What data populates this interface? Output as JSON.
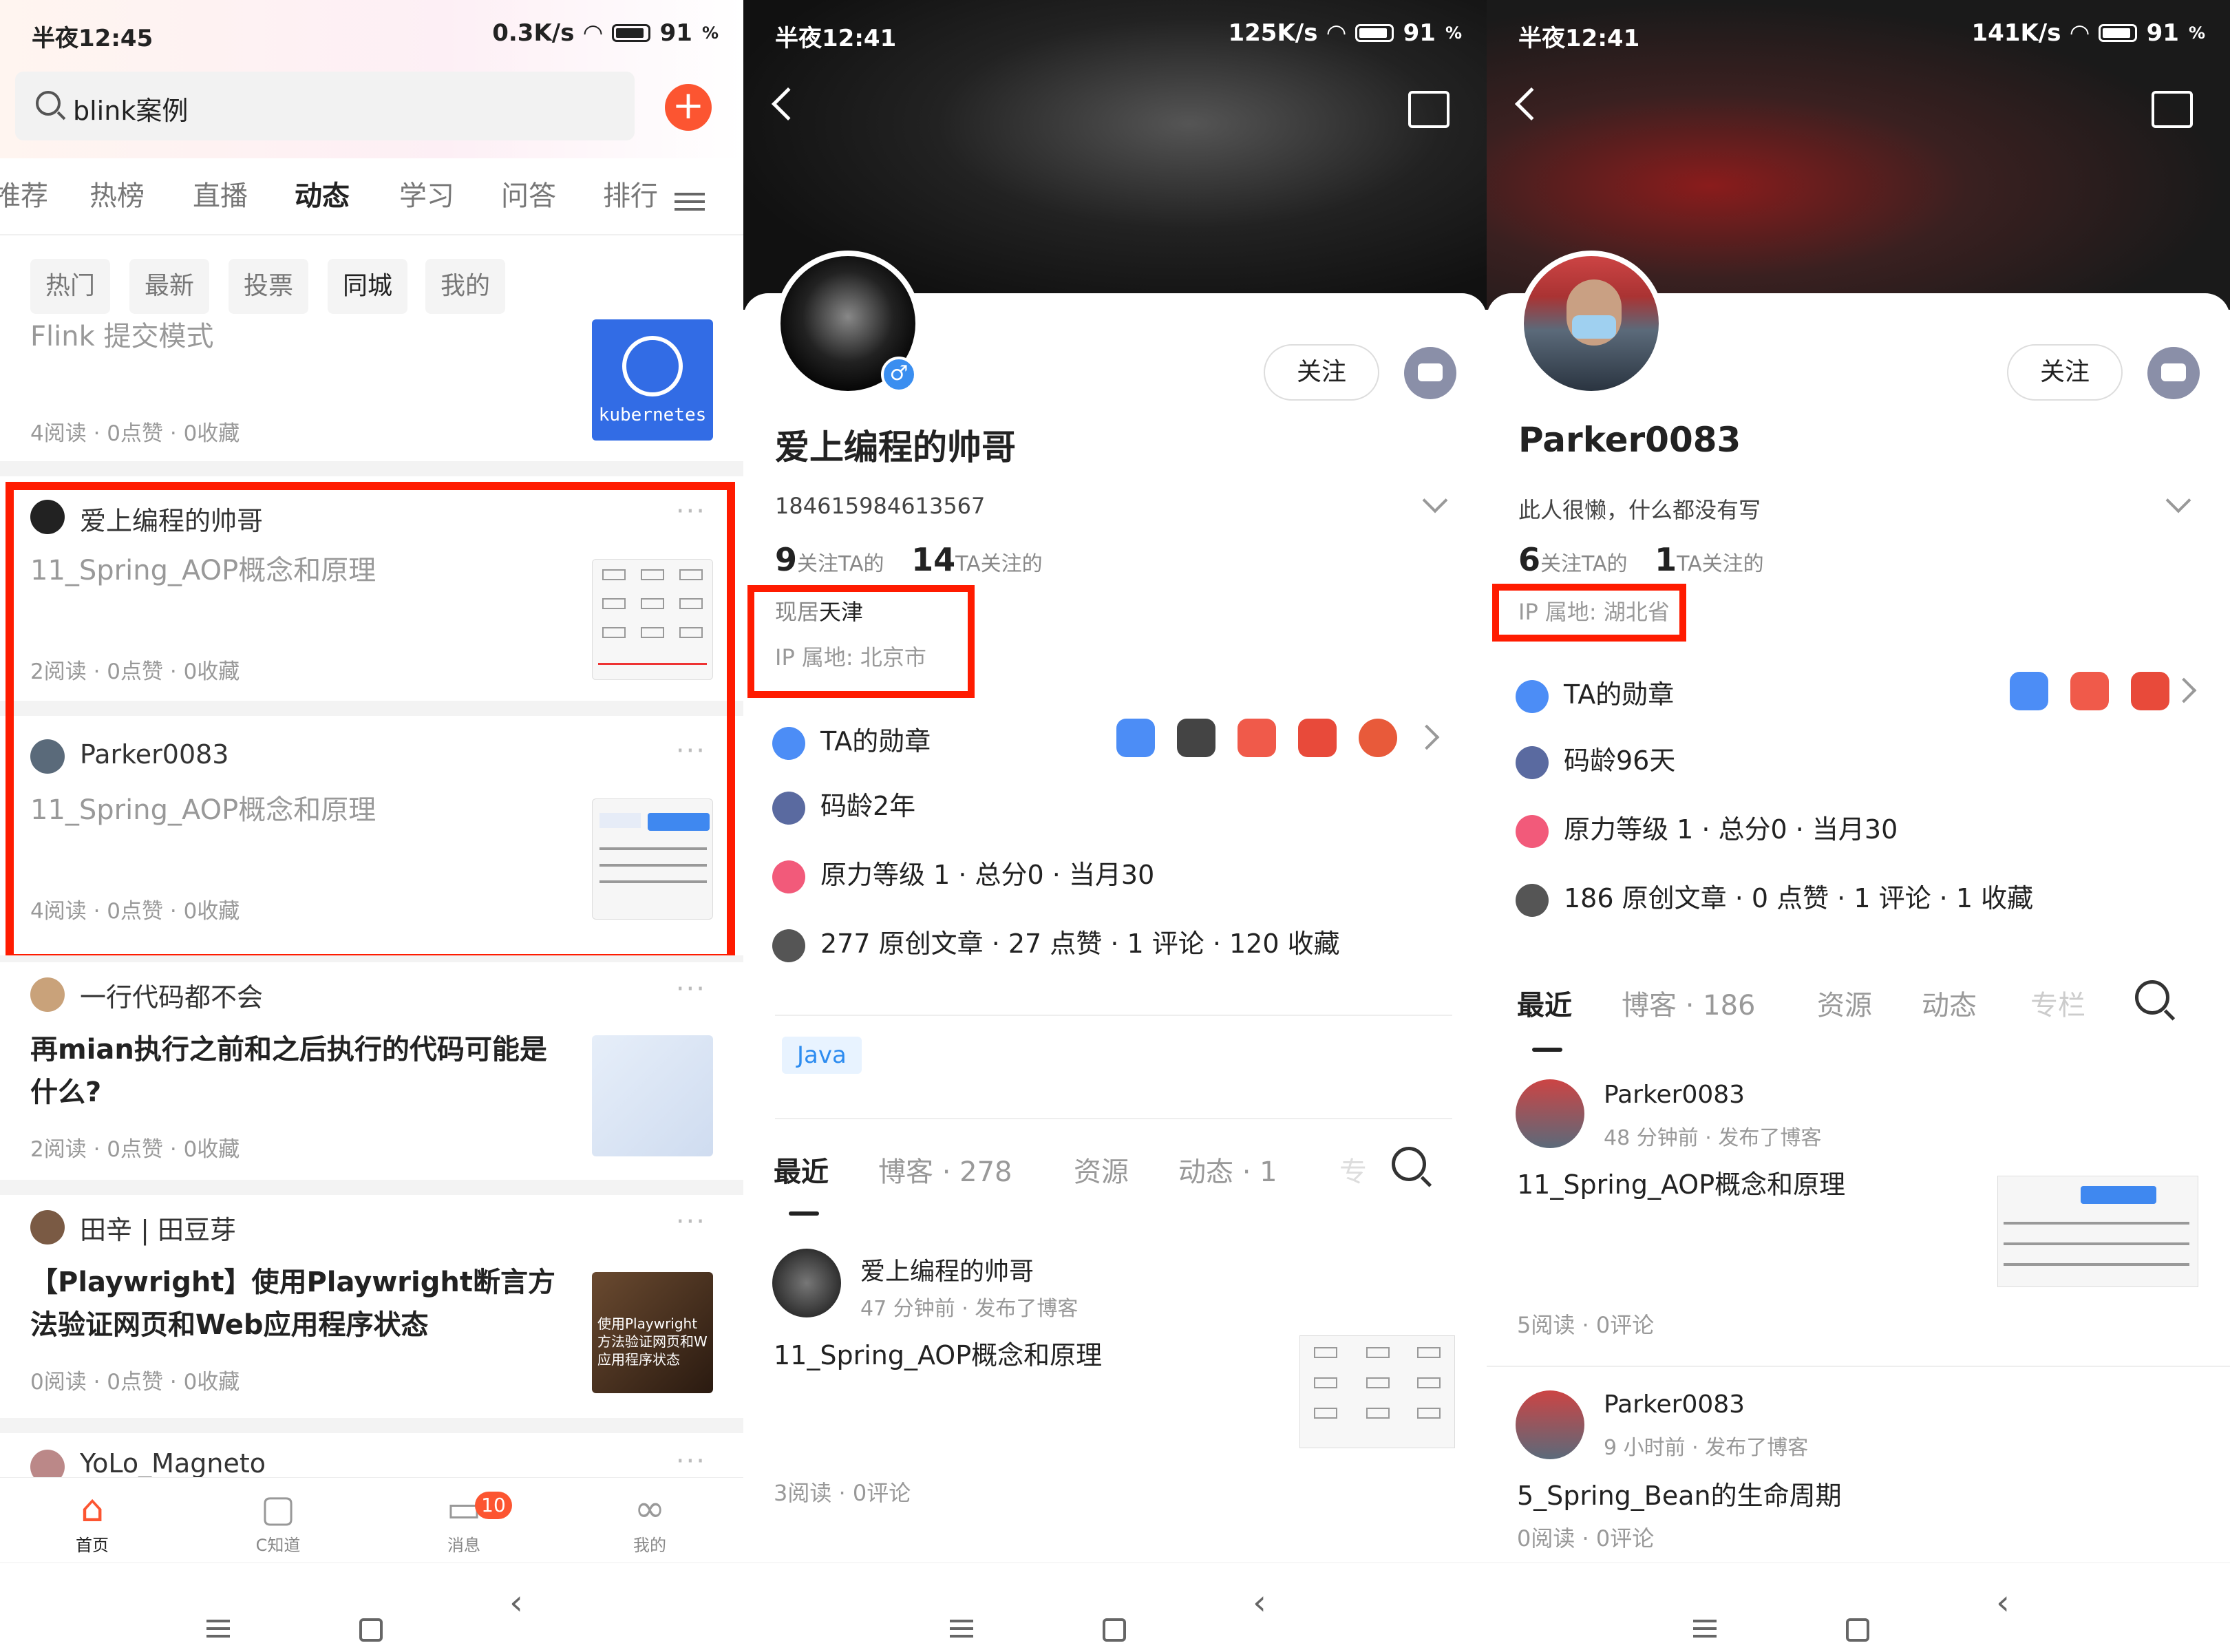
{
  "phone1": {
    "status": {
      "time": "半夜12:45",
      "speed": "0.3K/s",
      "battery": "91"
    },
    "search": {
      "query": "blink案例"
    },
    "tabs": [
      "推荐",
      "热榜",
      "直播",
      "动态",
      "学习",
      "问答",
      "排行"
    ],
    "active_tab": "动态",
    "subtabs": [
      "热门",
      "最新",
      "投票",
      "同城",
      "我的"
    ],
    "active_subtab": "同城",
    "feed": [
      {
        "author": "",
        "title": "Flink 提交模式",
        "meta": "4阅读 · 0点赞 · 0收藏",
        "thumb_label": "kubernetes"
      },
      {
        "author": "爱上编程的帅哥",
        "title": "11_Spring_AOP概念和原理",
        "meta": "2阅读 · 0点赞 · 0收藏"
      },
      {
        "author": "Parker0083",
        "title": "11_Spring_AOP概念和原理",
        "meta": "4阅读 · 0点赞 · 0收藏"
      },
      {
        "author": "一行代码都不会",
        "title": "再mian执行之前和之后执行的代码可能是什么?",
        "meta": "2阅读 · 0点赞 · 0收藏"
      },
      {
        "author": "田辛 | 田豆芽",
        "title": "【Playwright】使用Playwright断言方法验证网页和Web应用程序状态",
        "meta": "0阅读 · 0点赞 · 0收藏",
        "thumb_label": "使用Playwright 方法验证网页和W 应用程序状态"
      },
      {
        "author": "YoLo_Magneto",
        "title": "",
        "meta": ""
      }
    ],
    "bottom_nav": [
      {
        "label": "首页",
        "icon": "home-icon"
      },
      {
        "label": "C知道",
        "icon": "robot-icon"
      },
      {
        "label": "消息",
        "icon": "message-icon",
        "badge": "10"
      },
      {
        "label": "我的",
        "icon": "profile-icon"
      }
    ]
  },
  "phone2": {
    "status": {
      "time": "半夜12:41",
      "speed": "125K/s",
      "battery": "91"
    },
    "profile": {
      "name": "爱上编程的帅哥",
      "bio": "184615984613567",
      "followers": "9",
      "followers_label": "关注TA的",
      "following": "14",
      "following_label": "TA关注的",
      "location_prefix": "现居",
      "location": "天津",
      "ip": "IP 属地: 北京市",
      "follow_button": "关注",
      "medals_label": "TA的勋章",
      "code_age": "码龄2年",
      "power": "原力等级 1 · 总分0 · 当月30",
      "articles": "277 原创文章 · 27 点赞 · 1 评论 · 120 收藏",
      "tag": "Java"
    },
    "tabs": [
      "最近",
      "博客 · 278",
      "资源",
      "动态 · 1",
      "专"
    ],
    "posts": [
      {
        "author": "爱上编程的帅哥",
        "time": "47 分钟前 · 发布了博客",
        "title": "11_Spring_AOP概念和原理",
        "meta": "3阅读 · 0评论"
      }
    ]
  },
  "phone3": {
    "status": {
      "time": "半夜12:41",
      "speed": "141K/s",
      "battery": "91"
    },
    "profile": {
      "name": "Parker0083",
      "bio": "此人很懒，什么都没有写",
      "followers": "6",
      "followers_label": "关注TA的",
      "following": "1",
      "following_label": "TA关注的",
      "ip": "IP 属地: 湖北省",
      "follow_button": "关注",
      "medals_label": "TA的勋章",
      "code_age": "码龄96天",
      "power": "原力等级 1 · 总分0 · 当月30",
      "articles": "186 原创文章 · 0 点赞 · 1 评论 · 1 收藏"
    },
    "tabs": [
      "最近",
      "博客 · 186",
      "资源",
      "动态",
      "专栏"
    ],
    "posts": [
      {
        "author": "Parker0083",
        "time": "48 分钟前 · 发布了博客",
        "title": "11_Spring_AOP概念和原理",
        "meta": "5阅读 · 0评论"
      },
      {
        "author": "Parker0083",
        "time": "9 小时前 · 发布了博客",
        "title": "5_Spring_Bean的生命周期",
        "meta": "0阅读 · 0评论"
      }
    ]
  },
  "colors": {
    "accent": "#fc5531",
    "highlight_box": "#ff1b00",
    "tag_blue": "#2d8cf0"
  }
}
